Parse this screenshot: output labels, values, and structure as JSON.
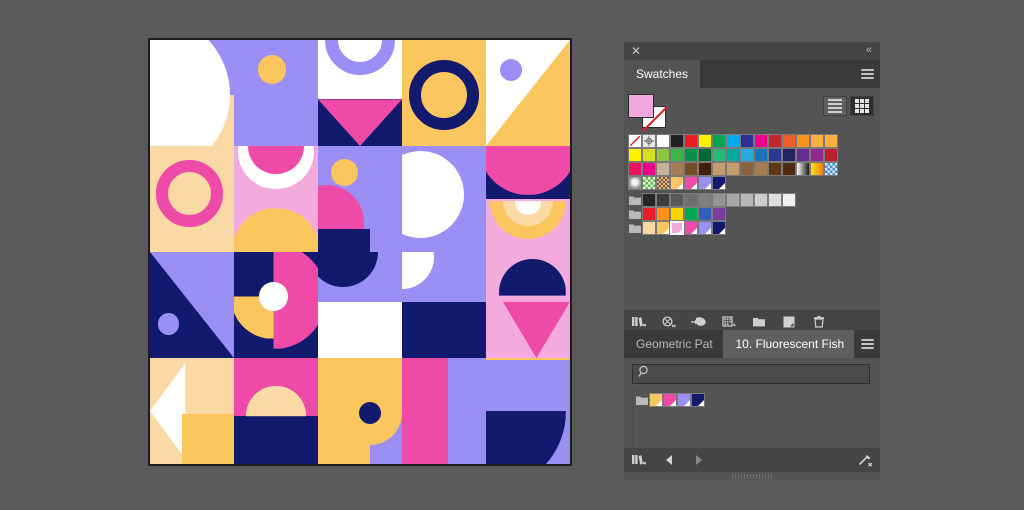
{
  "app": {
    "background": "#5a5a5a"
  },
  "artwork": {
    "name": "geometric-pattern-artboard",
    "palette": {
      "navy": "#121a6e",
      "purple": "#9b8ef5",
      "pink": "#ee4ba8",
      "lightpink": "#f3abdd",
      "yellow": "#fcc council",
      "gold": "#fbc65a",
      "peach": "#fbd9a4",
      "white": "#ffffff"
    },
    "grid": {
      "cols": 5,
      "rows": 4
    }
  },
  "swatches_panel": {
    "title": "Swatches",
    "close_label": "✕",
    "collapse_label": "«",
    "menu_label": "panel-menu",
    "fill_color": "#f0a9dd",
    "stroke_color": "none",
    "view_list_label": "list-view",
    "view_grid_label": "grid-view",
    "rows": [
      {
        "type": "colors",
        "cells": [
          {
            "kind": "none"
          },
          {
            "kind": "registration"
          },
          {
            "kind": "color",
            "hex": "#ffffff"
          },
          {
            "kind": "color",
            "hex": "#231f20"
          },
          {
            "kind": "color",
            "hex": "#ed1c24"
          },
          {
            "kind": "color",
            "hex": "#fff200"
          },
          {
            "kind": "color",
            "hex": "#00a651"
          },
          {
            "kind": "color",
            "hex": "#00aeef"
          },
          {
            "kind": "color",
            "hex": "#2e3192"
          },
          {
            "kind": "color",
            "hex": "#ec008c"
          },
          {
            "kind": "color",
            "hex": "#c1272d"
          },
          {
            "kind": "color",
            "hex": "#f15a29"
          },
          {
            "kind": "color",
            "hex": "#f7931e"
          },
          {
            "kind": "color",
            "hex": "#fbb040"
          },
          {
            "kind": "color",
            "hex": "#fcb040"
          }
        ]
      },
      {
        "type": "colors",
        "cells": [
          {
            "kind": "color",
            "hex": "#fff200"
          },
          {
            "kind": "color",
            "hex": "#d7df23"
          },
          {
            "kind": "color",
            "hex": "#8dc63f"
          },
          {
            "kind": "color",
            "hex": "#39b54a"
          },
          {
            "kind": "color",
            "hex": "#009245"
          },
          {
            "kind": "color",
            "hex": "#006837"
          },
          {
            "kind": "color",
            "hex": "#2bb673"
          },
          {
            "kind": "color",
            "hex": "#00a99d"
          },
          {
            "kind": "color",
            "hex": "#29abe2"
          },
          {
            "kind": "color",
            "hex": "#1b75bb"
          },
          {
            "kind": "color",
            "hex": "#2b3990"
          },
          {
            "kind": "color",
            "hex": "#262262"
          },
          {
            "kind": "color",
            "hex": "#662d91"
          },
          {
            "kind": "color",
            "hex": "#92278f"
          },
          {
            "kind": "color",
            "hex": "#be1e2d"
          }
        ]
      },
      {
        "type": "colors",
        "cells": [
          {
            "kind": "color",
            "hex": "#ed145b"
          },
          {
            "kind": "color",
            "hex": "#ec008c"
          },
          {
            "kind": "color",
            "hex": "#c7b299"
          },
          {
            "kind": "color",
            "hex": "#a67c52"
          },
          {
            "kind": "color",
            "hex": "#754c24"
          },
          {
            "kind": "color",
            "hex": "#42210b"
          },
          {
            "kind": "color",
            "hex": "#c69c6d"
          },
          {
            "kind": "color",
            "hex": "#c69c6d"
          },
          {
            "kind": "color",
            "hex": "#8c6239"
          },
          {
            "kind": "color",
            "hex": "#a97c50"
          },
          {
            "kind": "color",
            "hex": "#603813"
          },
          {
            "kind": "color",
            "hex": "#4c2b10"
          },
          {
            "kind": "gradient",
            "label": "white-black-gradient"
          },
          {
            "kind": "gradient",
            "label": "yellow-orange-gradient"
          },
          {
            "kind": "pattern",
            "label": "blue-checker-gradient"
          }
        ]
      },
      {
        "type": "mixed",
        "cells": [
          {
            "kind": "pattern",
            "label": "gray-sphere-pattern"
          },
          {
            "kind": "pattern",
            "label": "green-leaf-pattern"
          },
          {
            "kind": "pattern",
            "label": "confetti-pattern"
          },
          {
            "kind": "spot",
            "hex": "#fbc565"
          },
          {
            "kind": "spot",
            "hex": "#ee4ba8"
          },
          {
            "kind": "spot",
            "hex": "#9b8ef5"
          },
          {
            "kind": "spot",
            "hex": "#121a6e"
          }
        ]
      },
      {
        "type": "folder-grays",
        "folder_label": "grays-group",
        "cells": [
          {
            "kind": "color",
            "hex": "#262626"
          },
          {
            "kind": "color",
            "hex": "#3d3d3d"
          },
          {
            "kind": "color",
            "hex": "#595959"
          },
          {
            "kind": "color",
            "hex": "#6e6e6e"
          },
          {
            "kind": "color",
            "hex": "#808080"
          },
          {
            "kind": "color",
            "hex": "#949494"
          },
          {
            "kind": "color",
            "hex": "#a6a6a6"
          },
          {
            "kind": "color",
            "hex": "#b8b8b8"
          },
          {
            "kind": "color",
            "hex": "#cccccc"
          },
          {
            "kind": "color",
            "hex": "#dedede"
          },
          {
            "kind": "color",
            "hex": "#f0f0f0"
          }
        ]
      },
      {
        "type": "folder-brights",
        "folder_label": "brights-group",
        "cells": [
          {
            "kind": "color",
            "hex": "#ed1c24"
          },
          {
            "kind": "color",
            "hex": "#f7941e"
          },
          {
            "kind": "color",
            "hex": "#ffd400"
          },
          {
            "kind": "color",
            "hex": "#00a651"
          },
          {
            "kind": "color",
            "hex": "#2e5fba"
          },
          {
            "kind": "color",
            "hex": "#7a3f9d"
          }
        ]
      },
      {
        "type": "folder-fish",
        "folder_label": "fluorescent-fish-group",
        "cells": [
          {
            "kind": "color",
            "hex": "#fbd9a4"
          },
          {
            "kind": "spot",
            "hex": "#fbc565"
          },
          {
            "kind": "spot-selected",
            "hex": "#f3abdd"
          },
          {
            "kind": "spot",
            "hex": "#ee4ba8"
          },
          {
            "kind": "spot",
            "hex": "#9b8ef5"
          },
          {
            "kind": "spot",
            "hex": "#121a6e"
          }
        ]
      }
    ],
    "footer_icons": [
      {
        "name": "swatch-libraries-menu-icon",
        "label": "Swatch Libraries menu"
      },
      {
        "name": "show-swatch-kinds-menu-icon",
        "label": "Show Swatch Kinds menu"
      },
      {
        "name": "swatch-options-icon",
        "label": "Swatch Options"
      },
      {
        "name": "new-color-group-icon",
        "label": "New Color Group"
      },
      {
        "name": "swatch-options-panel-icon",
        "label": "Swatch Options"
      },
      {
        "name": "new-color-group-folder-icon",
        "label": "New Color Group"
      },
      {
        "name": "new-swatch-icon",
        "label": "New Swatch"
      },
      {
        "name": "delete-swatch-icon",
        "label": "Delete Swatch"
      }
    ]
  },
  "library_panel": {
    "tabs": [
      {
        "label": "Geometric Pat",
        "active": false
      },
      {
        "label": "10. Fluorescent Fish",
        "active": true
      }
    ],
    "menu_label": "panel-menu",
    "search_placeholder": "",
    "search_value": "",
    "group": {
      "folder_label": "fluorescent-fish-folder",
      "swatches": [
        {
          "kind": "spot",
          "hex": "#fbc565"
        },
        {
          "kind": "spot",
          "hex": "#ee4ba8"
        },
        {
          "kind": "spot",
          "hex": "#9b8ef5"
        },
        {
          "kind": "spot",
          "hex": "#121a6e"
        }
      ]
    },
    "footer_icons": [
      {
        "name": "swatch-libraries-menu-icon",
        "label": "Swatch Libraries menu"
      },
      {
        "name": "previous-library-icon",
        "label": "Load Previous Swatch Library"
      },
      {
        "name": "next-library-icon",
        "label": "Load Next Swatch Library"
      },
      {
        "name": "persistent-library-icon",
        "label": "Persistent"
      }
    ]
  }
}
